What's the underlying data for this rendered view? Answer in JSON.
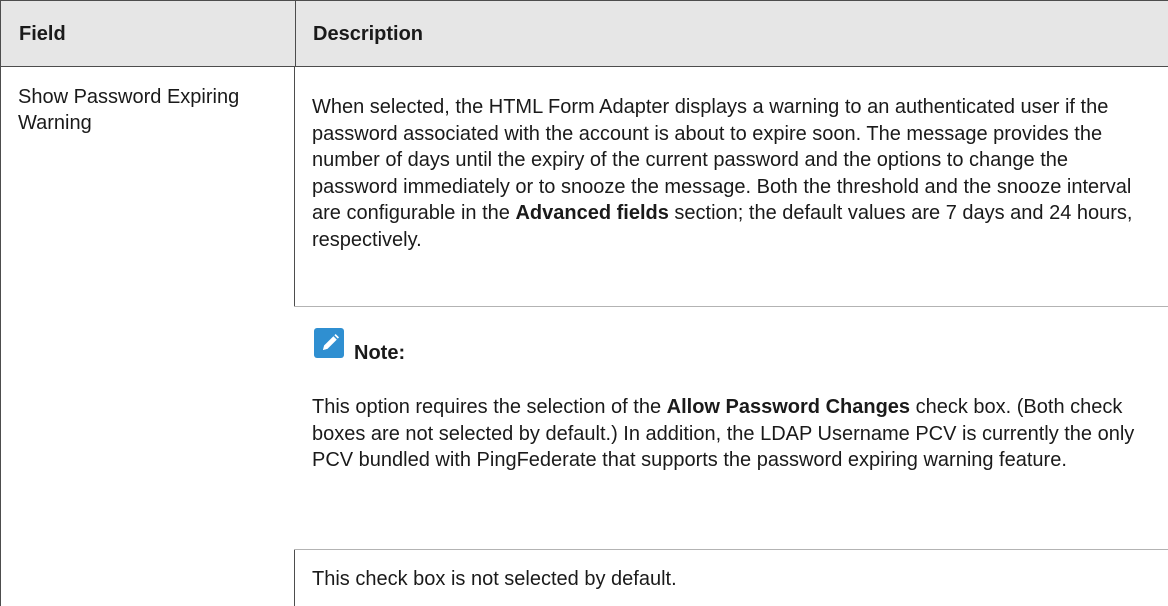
{
  "table": {
    "headers": {
      "field": "Field",
      "description": "Description"
    },
    "row": {
      "field": "Show Password Expiring Warning",
      "description": {
        "text_1": "When selected, the HTML Form Adapter displays a warning to an authenticated user if the password associated with the account is about to expire soon. The message provides the number of days until the expiry of the current password and the options to change the password immediately or to snooze the message. Both the threshold and the snooze interval are configurable in the ",
        "bold_1": "Advanced fields",
        "text_2": " section; the default values are 7 days and 24 hours, respectively."
      },
      "note": {
        "icon": "pencil-icon",
        "title": "Note:",
        "text_1": "This option requires the selection of the ",
        "bold_1": "Allow Password Changes",
        "text_2": " check box. (Both check boxes are not selected by default.) In addition, the LDAP Username PCV is currently the only PCV bundled with PingFederate that supports the password expiring warning feature."
      },
      "default_text": "This check box is not selected by default."
    }
  },
  "colors": {
    "header_bg": "#e6e6e6",
    "border": "#4d4d4d",
    "note_icon": "#2f8fd1"
  }
}
